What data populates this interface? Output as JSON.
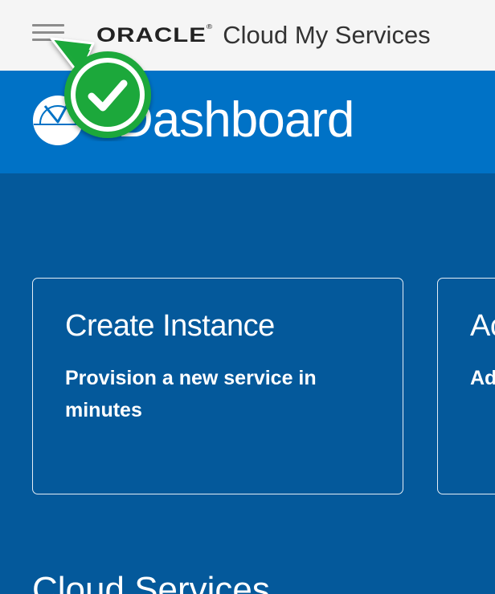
{
  "header": {
    "brand_logo": "ORACLE",
    "brand_mark": "®",
    "app_name": "Cloud My Services",
    "menu_icon": "hamburger-menu-icon"
  },
  "title_band": {
    "icon": "dashboard-gauge-icon",
    "title": "Dashboard"
  },
  "cards": [
    {
      "title": "Create Instance",
      "description": "Provision a new service in minutes"
    },
    {
      "title": "Ac",
      "description": "Ad ac"
    }
  ],
  "section": {
    "title": "Cloud Services"
  },
  "overlay": {
    "icon": "check-pointer-icon",
    "color": "#16b83a"
  },
  "colors": {
    "header_bg": "#f5f5f5",
    "title_band_bg": "#0072c6",
    "main_bg": "#04599b"
  }
}
